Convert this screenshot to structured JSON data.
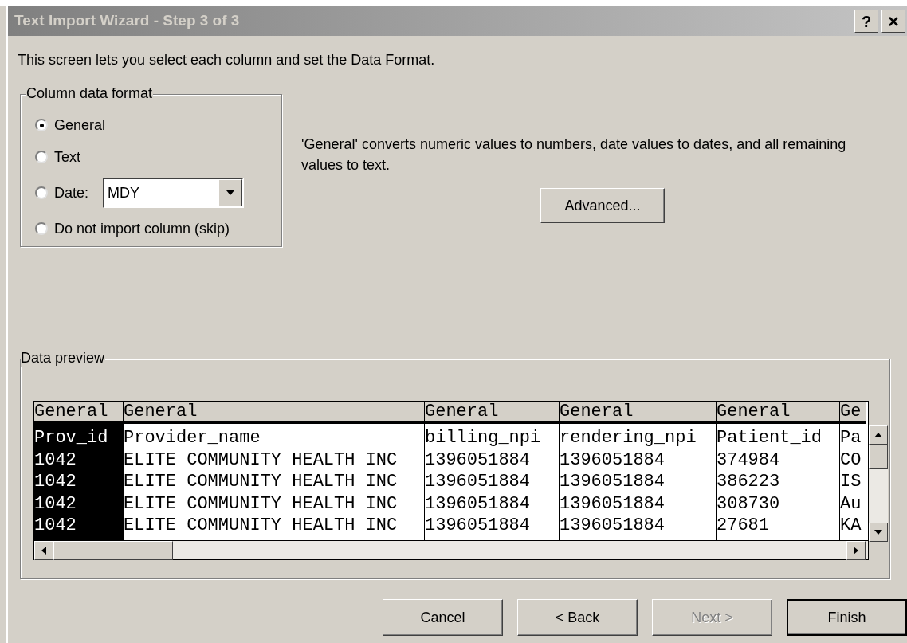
{
  "window": {
    "title": "Text Import Wizard - Step 3 of 3",
    "help_button": "?",
    "close_button": "×"
  },
  "intro": "This screen lets you select each column and set the Data Format.",
  "column_data_format": {
    "title": "Column data format",
    "options": [
      {
        "kind": "radio",
        "label": "General",
        "selected": true
      },
      {
        "kind": "radio",
        "label": "Text",
        "selected": false
      },
      {
        "kind": "radio_dropdown",
        "label": "Date:",
        "selected": false,
        "dropdown": {
          "value": "MDY"
        }
      },
      {
        "kind": "radio",
        "label": "Do not import column (skip)",
        "selected": false
      }
    ]
  },
  "description": "'General' converts numeric values to numbers, date values to dates, and all remaining values to text.",
  "advanced_button": "Advanced...",
  "data_preview": {
    "title": "Data preview",
    "columns": [
      {
        "header": "General",
        "selected": true,
        "cells": [
          "Prov_id",
          "1042",
          "1042",
          "1042",
          "1042"
        ]
      },
      {
        "header": "General",
        "selected": false,
        "cells": [
          "Provider_name",
          "ELITE COMMUNITY HEALTH INC",
          "ELITE COMMUNITY HEALTH INC",
          "ELITE COMMUNITY HEALTH INC",
          "ELITE COMMUNITY HEALTH INC"
        ]
      },
      {
        "header": "General",
        "selected": false,
        "cells": [
          "billing_npi",
          "1396051884",
          "1396051884",
          "1396051884",
          "1396051884"
        ]
      },
      {
        "header": "General",
        "selected": false,
        "cells": [
          "rendering_npi",
          "1396051884",
          "1396051884",
          "1396051884",
          "1396051884"
        ]
      },
      {
        "header": "General",
        "selected": false,
        "cells": [
          "Patient_id",
          "374984",
          "386223",
          "308730",
          "27681"
        ]
      },
      {
        "header": "Ge",
        "selected": false,
        "cells": [
          "Pa",
          "CO",
          "IS",
          "Au",
          "KA"
        ]
      }
    ]
  },
  "buttons": [
    {
      "label": "Cancel",
      "disabled": false,
      "default": false
    },
    {
      "label": "< Back",
      "disabled": false,
      "default": false
    },
    {
      "label": "Next >",
      "disabled": true,
      "default": false
    },
    {
      "label": "Finish",
      "disabled": false,
      "default": true
    }
  ]
}
